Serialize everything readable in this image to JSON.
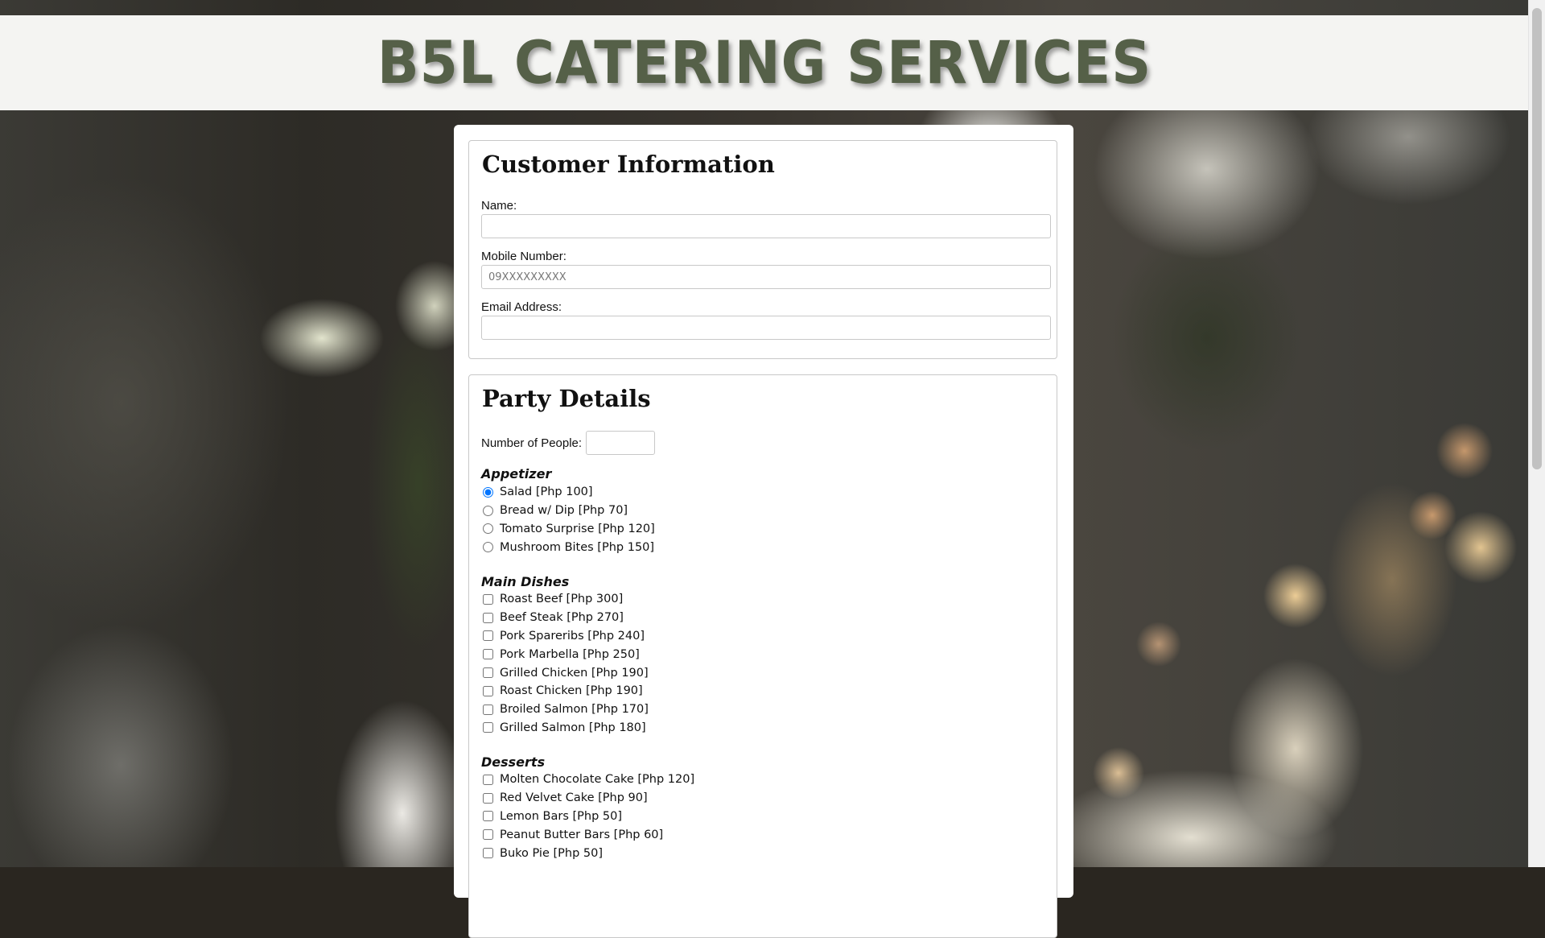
{
  "header": {
    "title": "B5L CATERING SERVICES"
  },
  "customer": {
    "title": "Customer Information",
    "name_label": "Name:",
    "name_value": "",
    "mobile_label": "Mobile Number:",
    "mobile_placeholder": "09XXXXXXXXX",
    "email_label": "Email Address:",
    "email_value": ""
  },
  "party": {
    "title": "Party Details",
    "people_label": "Number of People:",
    "people_value": "",
    "appetizer": {
      "title": "Appetizer",
      "selected": "Salad [Php 100]",
      "items": [
        "Salad [Php 100]",
        "Bread w/ Dip [Php 70]",
        "Tomato Surprise [Php 120]",
        "Mushroom Bites [Php 150]"
      ]
    },
    "main": {
      "title": "Main Dishes",
      "items": [
        "Roast Beef [Php 300]",
        "Beef Steak [Php 270]",
        "Pork Spareribs [Php 240]",
        "Pork Marbella [Php 250]",
        "Grilled Chicken [Php 190]",
        "Roast Chicken [Php 190]",
        "Broiled Salmon [Php 170]",
        "Grilled Salmon [Php 180]"
      ]
    },
    "desserts": {
      "title": "Desserts",
      "items": [
        "Molten Chocolate Cake [Php 120]",
        "Red Velvet Cake [Php 90]",
        "Lemon Bars [Php 50]",
        "Peanut Butter Bars [Php 60]",
        "Buko Pie [Php 50]"
      ]
    }
  },
  "colors": {
    "title_green": "#556048",
    "header_bg": "#f4f4f2",
    "panel_bg": "#ffffff",
    "border": "#c8c8c8"
  }
}
